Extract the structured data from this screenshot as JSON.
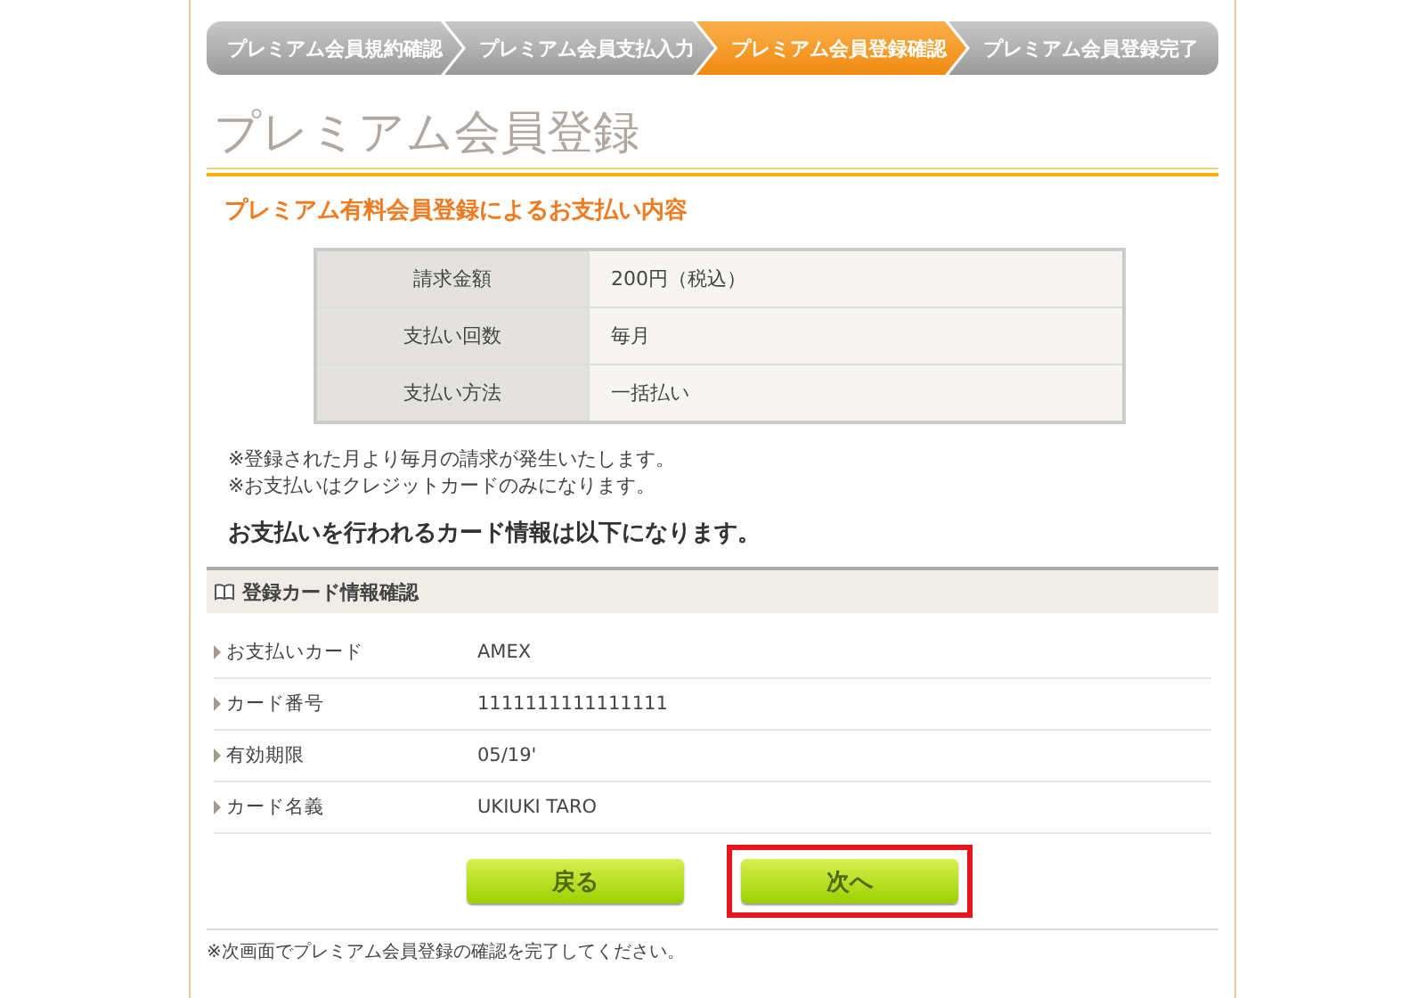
{
  "steps": [
    {
      "label": "プレミアム会員規約確認",
      "selected": false
    },
    {
      "label": "プレミアム会員支払入力",
      "selected": false
    },
    {
      "label": "プレミアム会員登録確認",
      "selected": true
    },
    {
      "label": "プレミアム会員登録完了",
      "selected": false
    }
  ],
  "title": "プレミアム会員登録",
  "subheading": "プレミアム有料会員登録によるお支払い内容",
  "summary": [
    {
      "label": "請求金額",
      "value": "200円（税込）"
    },
    {
      "label": "支払い回数",
      "value": "毎月"
    },
    {
      "label": "支払い方法",
      "value": "一括払い"
    }
  ],
  "notes": [
    "※登録された月より毎月の請求が発生いたします。",
    "※お支払いはクレジットカードのみになります。"
  ],
  "card_intro": "お支払いを行われるカード情報は以下になります。",
  "card_section": {
    "title": "登録カード情報確認",
    "rows": [
      {
        "label": "お支払いカード",
        "value": "AMEX"
      },
      {
        "label": "カード番号",
        "value": "1111111111111111"
      },
      {
        "label": "有効期限",
        "value": "05/19'"
      },
      {
        "label": "カード名義",
        "value": "UKIUKI TARO"
      }
    ]
  },
  "buttons": [
    {
      "label": "戻る",
      "highlighted": false
    },
    {
      "label": "次へ",
      "highlighted": true
    }
  ],
  "footer_note": "※次画面でプレミアム会員登録の確認を完了してください。"
}
